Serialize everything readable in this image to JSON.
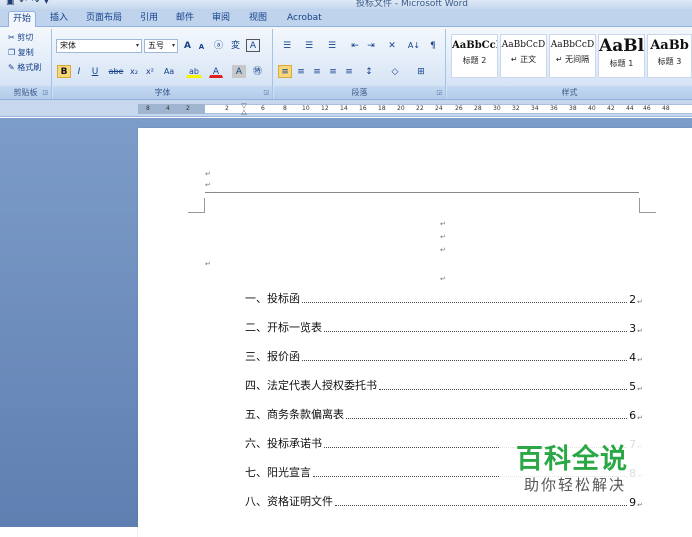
{
  "window": {
    "title": "投标文件 - Microsoft Word",
    "qat": "▣ ↶ ↷ ▾"
  },
  "tabs": [
    "开始",
    "插入",
    "页面布局",
    "引用",
    "邮件",
    "审阅",
    "视图",
    "Acrobat"
  ],
  "clipboard": {
    "cut": "剪切",
    "copy": "复制",
    "format_painter": "格式刷",
    "group_label": "剪贴板"
  },
  "font": {
    "name": "宋体",
    "size": "五号",
    "grow": "A",
    "shrink": "A",
    "clear": "ⓐ",
    "phonetic": "変",
    "border_char": "A",
    "bold": "B",
    "italic": "I",
    "underline": "U",
    "strike": "abe",
    "subscript": "x₂",
    "superscript": "x²",
    "change_case": "Aa",
    "highlight": "ab",
    "font_color": "A",
    "shading": "A",
    "enclose": "㊕",
    "group_label": "字体"
  },
  "paragraph": {
    "bullets": "☰",
    "numbering": "☰",
    "multilevel": "☰",
    "decrease_indent": "⇤",
    "increase_indent": "⇥",
    "chinese_layout": "✕",
    "sort": "A↓",
    "show_marks": "¶",
    "align_left": "≡",
    "center": "≡",
    "align_right": "≡",
    "justify": "≡",
    "distributed": "≡",
    "line_spacing": "↕",
    "shading": "◇",
    "borders": "⊞",
    "group_label": "段落"
  },
  "styles": {
    "items": [
      {
        "sample": "AaBbCcI",
        "name": "标题 2"
      },
      {
        "sample": "AaBbCcD",
        "name": "↵ 正文"
      },
      {
        "sample": "AaBbCcD",
        "name": "↵ 无间隔"
      },
      {
        "sample": "AaBl",
        "name": "标题 1"
      },
      {
        "sample": "AaBb",
        "name": "标题 3"
      }
    ],
    "group_label": "样式"
  },
  "ruler": {
    "ticks": [
      "8",
      "4",
      "2",
      "2",
      "6",
      "8",
      "10",
      "12",
      "14",
      "16",
      "18",
      "20",
      "22",
      "24",
      "26",
      "28",
      "30",
      "32",
      "34",
      "36",
      "38",
      "40",
      "42",
      "44",
      "46",
      "48"
    ]
  },
  "document": {
    "para_mark": "↵",
    "toc": [
      {
        "title": "一、投标函",
        "page": "2"
      },
      {
        "title": "二、开标一览表",
        "page": "3"
      },
      {
        "title": "三、报价函",
        "page": "4"
      },
      {
        "title": "四、法定代表人授权委托书",
        "page": "5"
      },
      {
        "title": "五、商务条款偏离表",
        "page": "6"
      },
      {
        "title": "六、投标承诺书",
        "page": "7"
      },
      {
        "title": "七、阳光宣言",
        "page": "8"
      },
      {
        "title": "八、资格证明文件",
        "page": "9"
      }
    ]
  },
  "watermark": {
    "big": "百科全说",
    "small": "助你轻松解决"
  }
}
